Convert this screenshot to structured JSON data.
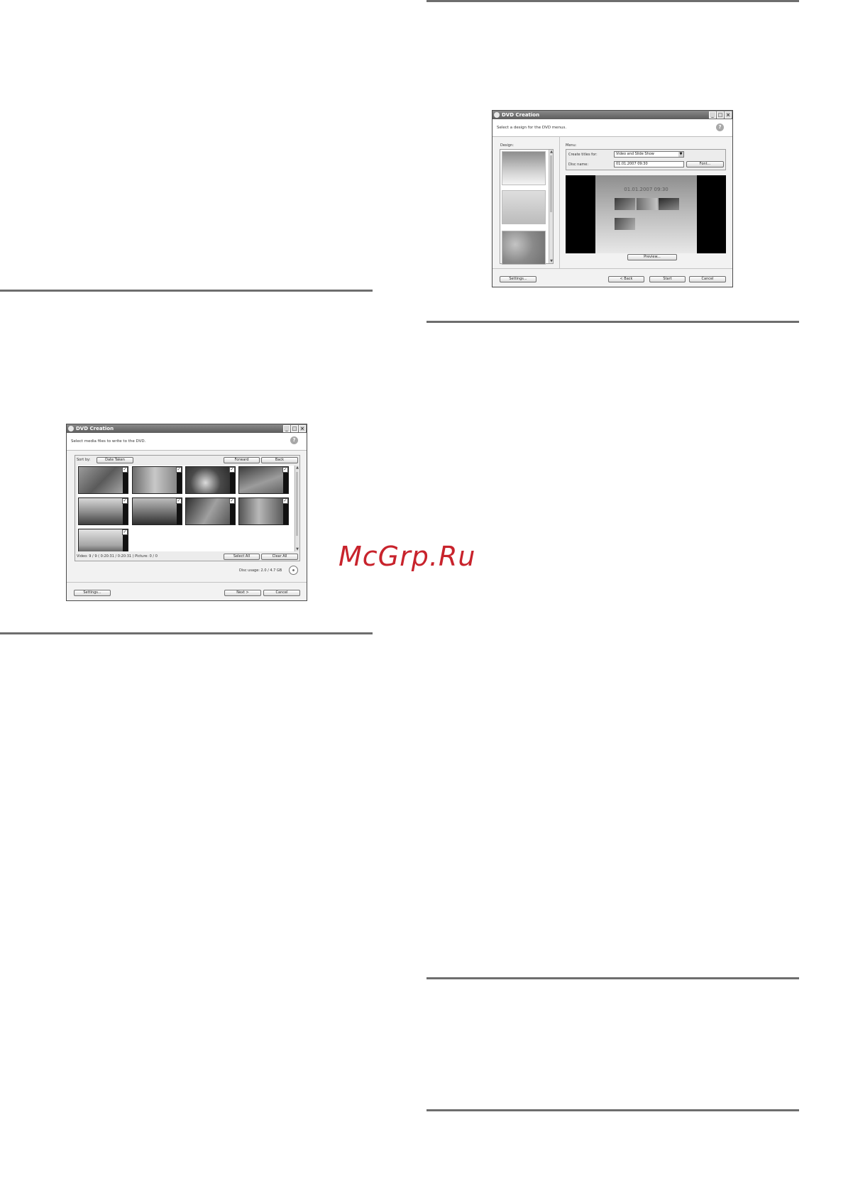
{
  "watermark": "McGrp.Ru",
  "window1": {
    "title": "DVD Creation",
    "instruction": "Select media files to write to the DVD.",
    "sort_label": "Sort by:",
    "sort_button": "Date Taken",
    "forward_button": "Forward",
    "back_button": "Back",
    "status": "Video: 9 / 9 ( 0:20:31 / 0:20:31 )  Picture: 0 / 0",
    "select_all": "Select All",
    "clear_all": "Clear All",
    "disc_usage": "Disc usage: 2.0 / 4.7 GB",
    "settings_button": "Settings...",
    "next_button": "Next >",
    "cancel_button": "Cancel",
    "thumbnails_checked": [
      true,
      true,
      true,
      true,
      true,
      true,
      true,
      true,
      true
    ]
  },
  "window2": {
    "title": "DVD Creation",
    "instruction": "Select a design for the DVD menus.",
    "design_label": "Design:",
    "menu_label": "Menu:",
    "create_titles_label": "Create titles for:",
    "create_titles_value": "Video and Slide Show",
    "disc_name_label": "Disc name:",
    "disc_name_value": "01.01.2007  09:30",
    "font_button": "Font...",
    "preview_title": "01.01.2007  09:30",
    "preview_button": "Preview...",
    "settings_button": "Settings...",
    "back_button": "< Back",
    "start_button": "Start",
    "cancel_button": "Cancel"
  }
}
